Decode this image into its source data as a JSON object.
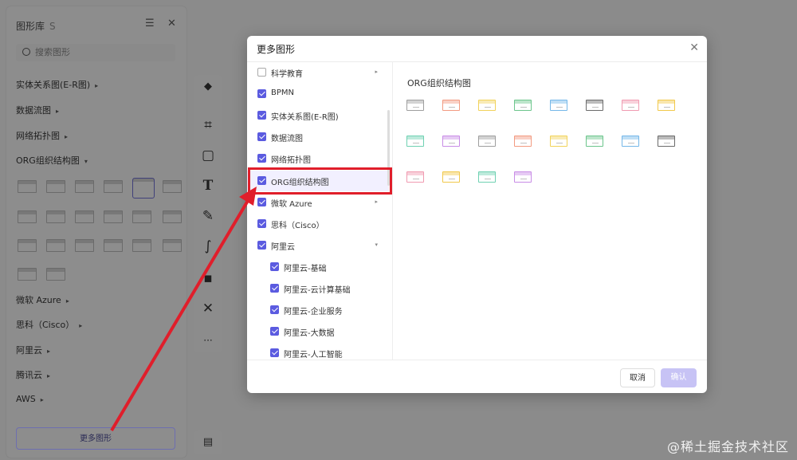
{
  "library": {
    "title": "图形库",
    "shortcut": "S",
    "search_placeholder": "搜索图形",
    "categories": [
      "实体关系图(E-R图)",
      "数据流图",
      "网络拓扑图",
      "ORG组织结构图"
    ],
    "lower_categories": [
      "微软 Azure",
      "思科（Cisco）",
      "阿里云",
      "腾讯云",
      "AWS"
    ],
    "more_shapes": "更多图形"
  },
  "dialog": {
    "title": "更多图形",
    "items": [
      {
        "label": "科学教育",
        "checked": false,
        "caret": true
      },
      {
        "label": "BPMN",
        "checked": true
      },
      {
        "label": "实体关系图(E-R图)",
        "checked": true
      },
      {
        "label": "数据流图",
        "checked": true
      },
      {
        "label": "网络拓扑图",
        "checked": true
      },
      {
        "label": "ORG组织结构图",
        "checked": true,
        "selected": true
      },
      {
        "label": "微软 Azure",
        "checked": true,
        "caret": true
      },
      {
        "label": "思科（Cisco）",
        "checked": true
      },
      {
        "label": "阿里云",
        "checked": true,
        "caret": true
      },
      {
        "label": "阿里云-基础",
        "checked": true,
        "sub": true
      },
      {
        "label": "阿里云-云计算基础",
        "checked": true,
        "sub": true
      },
      {
        "label": "阿里云-企业服务",
        "checked": true,
        "sub": true
      },
      {
        "label": "阿里云-大数据",
        "checked": true,
        "sub": true
      },
      {
        "label": "阿里云-人工智能",
        "checked": true,
        "sub": true
      }
    ],
    "section_title": "ORG组织结构图",
    "cancel": "取消",
    "confirm": "确认"
  },
  "tile_colors": [
    "#9e9e9e",
    "#f29a80",
    "#f1d25a",
    "#6cc58c",
    "#74b7e8",
    "#6b6b6b",
    "#f09ab0",
    "#f1c84a",
    "#6fd1b2",
    "#c88ce6",
    "#9e9e9e",
    "#f29a80",
    "#f1d25a",
    "#6cc58c",
    "#74b7e8",
    "#6b6b6b",
    "#f09ab0",
    "#f1c84a",
    "#6fd1b2",
    "#c88ce6"
  ],
  "watermark": "@稀土掘金技术社区"
}
